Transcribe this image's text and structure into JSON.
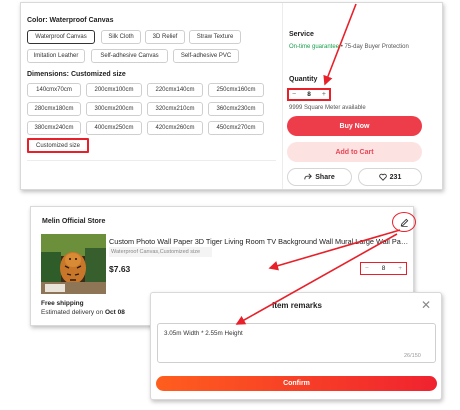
{
  "product": {
    "color_label": "Color: Waterproof Canvas",
    "materials": [
      "Waterproof Canvas",
      "Silk Cloth",
      "3D Relief",
      "Straw Texture",
      "Imitation Leather",
      "Self-adhesive Canvas",
      "Self-adhesive PVC"
    ],
    "dimensions_label": "Dimensions: Customized size",
    "sizes": [
      "140cmx70cm",
      "200cmx100cm",
      "220cmx140cm",
      "250cmx160cm",
      "280cmx180cm",
      "300cmx200cm",
      "320cmx210cm",
      "360cmx230cm",
      "380cmx240cm",
      "400cmx250cm",
      "420cmx260cm",
      "450cmx270cm",
      "Customized size"
    ]
  },
  "side": {
    "service_label": "Service",
    "guarantee": "On-time guarantee",
    "buyer_protection": " • 75-day Buyer Protection",
    "quantity_label": "Quantity",
    "quantity_minus": "−",
    "quantity_value": "8",
    "quantity_plus": "+",
    "available": "9999 Square Meter available",
    "buy_now": "Buy Now",
    "add_to_cart": "Add to Cart",
    "share": "Share",
    "like_count": "231"
  },
  "cart": {
    "store_name": "Melin Official Store",
    "title": "Custom Photo Wall Paper 3D Tiger Living Room TV Background Wall Mural Large Wall Pain...",
    "variant": "Waterproof Canvas,Customized size",
    "price": "$7.63",
    "qty_minus": "−",
    "qty_value": "8",
    "qty_plus": "+",
    "free_shipping": "Free shipping",
    "delivery_prefix": "Estimated delivery on ",
    "delivery_date": "Oct 08"
  },
  "remarks": {
    "title": "Item remarks",
    "text": "3.05m Width * 2.55m Height",
    "count": "26/150",
    "confirm": "Confirm"
  },
  "colors": {
    "accent_red": "#e8202a",
    "buy_now": "#ee3d4a",
    "add_to_cart_bg": "#fde2e2",
    "guarantee_green": "#16a04a",
    "confirm_start": "#ff5e1e",
    "confirm_end": "#f0222f"
  },
  "icons": [
    "share-icon",
    "heart-icon",
    "pencil-icon",
    "close-icon",
    "annotation-arrow"
  ]
}
